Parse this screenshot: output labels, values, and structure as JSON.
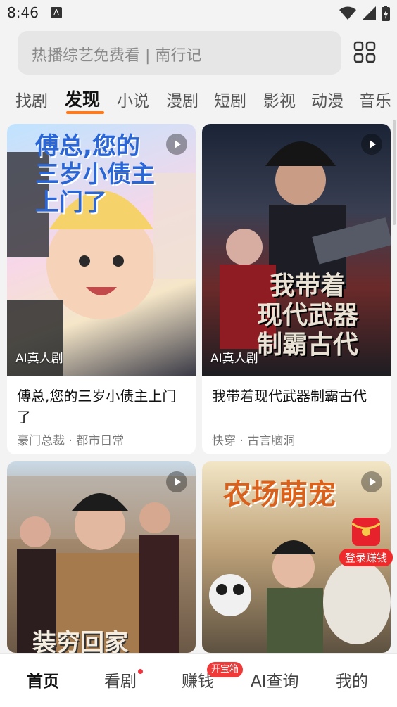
{
  "status_bar": {
    "time": "8:46",
    "notification": "A"
  },
  "search": {
    "placeholder": "热播综艺免费看 | 南行记"
  },
  "tabs": [
    {
      "label": "找剧"
    },
    {
      "label": "发现"
    },
    {
      "label": "小说"
    },
    {
      "label": "漫剧"
    },
    {
      "label": "短剧"
    },
    {
      "label": "影视"
    },
    {
      "label": "动漫"
    },
    {
      "label": "音乐"
    }
  ],
  "cards": [
    {
      "cover_text": "傅总,您的\n三岁小债主\n上门了",
      "tag": "AI真人剧",
      "title": "傅总,您的三岁小债主上门了",
      "meta": "豪门总裁 · 都市日常"
    },
    {
      "cover_text": "我带着\n现代武器\n制霸古代",
      "tag": "AI真人剧",
      "title": "我带着现代武器制霸古代",
      "meta": "快穿 · 古言脑洞"
    },
    {
      "cover_text": "装穷回家"
    },
    {
      "cover_text": "农场萌宠"
    }
  ],
  "promo": {
    "label": "登录赚钱"
  },
  "bottom_nav": [
    {
      "label": "首页"
    },
    {
      "label": "看剧"
    },
    {
      "label": "赚钱",
      "badge": "开宝箱"
    },
    {
      "label": "AI查询"
    },
    {
      "label": "我的"
    }
  ],
  "colors": {
    "accent": "#ff7a1a",
    "badge_red": "#f03a3a",
    "page_bg": "#f3f3f3"
  }
}
